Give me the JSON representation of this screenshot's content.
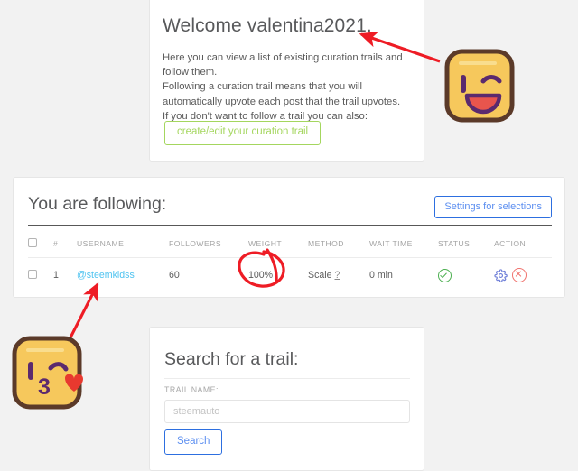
{
  "page": {
    "background_color": "#f2f2f2"
  },
  "welcome": {
    "title": "Welcome valentina2021,",
    "body_lines": [
      "Here you can view a list of existing curation trails and follow them.",
      "Following a curation trail means that you will automatically upvote each post that the trail upvotes.",
      "If you don't want to follow a trail you can also:"
    ],
    "cta_label": "create/edit your curation trail",
    "cta_color": "#a4d65e"
  },
  "following": {
    "title": "You are following:",
    "settings_button_label": "Settings for selections",
    "settings_button_color": "#2d6fe0",
    "columns": [
      "",
      "#",
      "USERNAME",
      "FOLLOWERS",
      "WEIGHT",
      "METHOD",
      "WAIT TIME",
      "STATUS",
      "ACTION"
    ],
    "rows": [
      {
        "selected": false,
        "index": "1",
        "username": "@steemkidss",
        "username_color": "#4ec3f0",
        "followers": "60",
        "weight": "100%",
        "method": "Scale",
        "method_help": "?",
        "wait_time": "0 min",
        "status_icon": "check-circle-icon",
        "status_color": "#4caf50",
        "action_icons": [
          "gear-icon",
          "x-circle-icon"
        ],
        "gear_color": "#6f7fd8",
        "x_color": "#f0736e"
      }
    ]
  },
  "search": {
    "title": "Search for a trail:",
    "field_label": "TRAIL NAME:",
    "input_value": "",
    "placeholder": "steemauto",
    "button_label": "Search",
    "button_color": "#2d6fe0"
  },
  "annotations": {
    "arrow_color": "#ee1c25",
    "circle_highlight_target": "100%",
    "arrows": [
      {
        "name": "arrow-to-welcome-title",
        "points_to": "Welcome valentina2021,"
      },
      {
        "name": "arrow-to-username",
        "points_to": "@steemkidss"
      }
    ],
    "stickers": [
      {
        "name": "winking-face-sticker",
        "face_color": "#f6c85c",
        "border_color": "#5b3a29"
      },
      {
        "name": "kissing-face-heart-sticker",
        "face_color": "#f6c85c",
        "border_color": "#5b3a29",
        "heart_color": "#e8392f"
      }
    ]
  }
}
